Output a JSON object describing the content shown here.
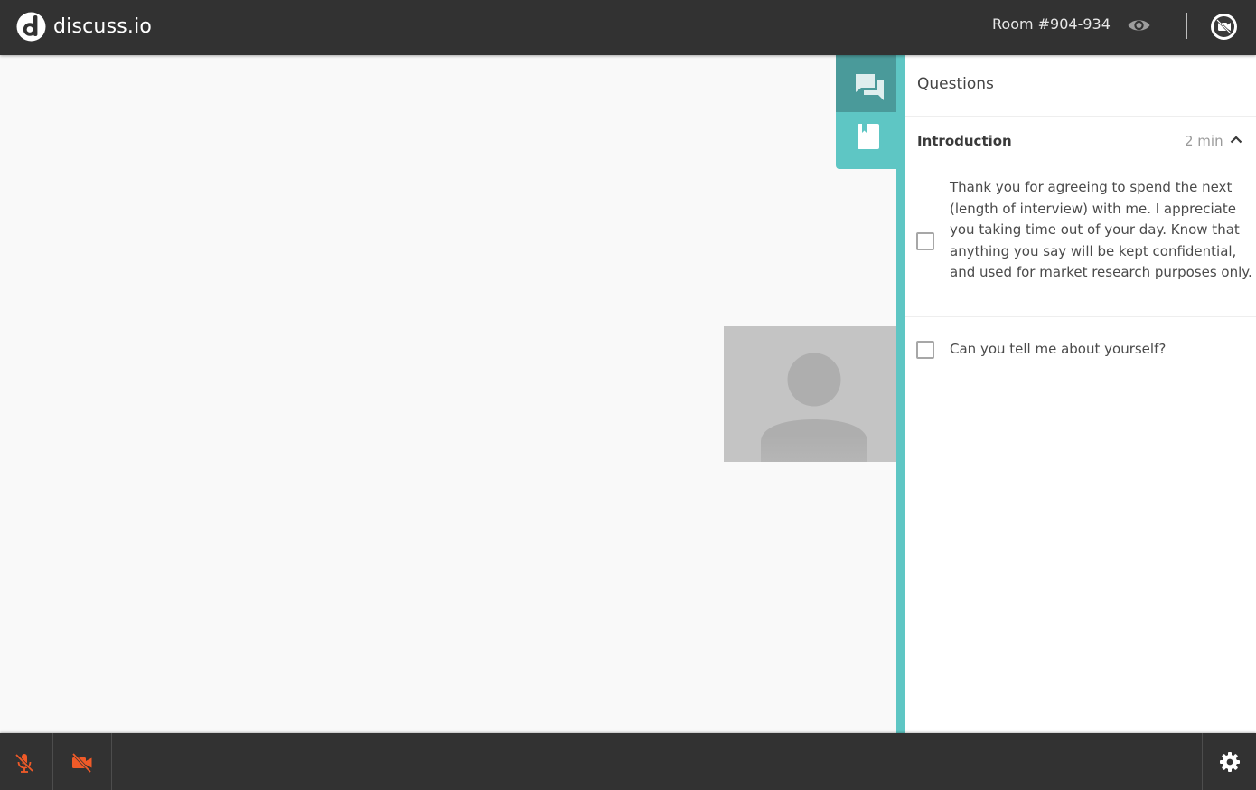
{
  "header": {
    "app_name": "discuss.io",
    "room_label": "Room #904-934",
    "icons": {
      "logo": "discuss-io-logo-icon",
      "view": "eye-icon",
      "camera_status": "camera-off-icon"
    }
  },
  "sidebar": {
    "tabs": [
      {
        "name": "chat",
        "icon": "chat-bubbles-icon"
      },
      {
        "name": "discussion-guide",
        "icon": "bookmark-book-icon"
      }
    ],
    "accent_color": "#5ec6c4"
  },
  "questions_panel": {
    "title": "Questions",
    "section": {
      "title": "Introduction",
      "duration": "2 min",
      "expanded": true
    },
    "items": [
      {
        "text": "Thank you for agreeing to spend the next (length of interview) with me. I appreciate you taking time out of your day. Know that anything you say will be kept confidential, and used for market research purposes only.",
        "checked": false
      },
      {
        "text": "Can you tell me about yourself?",
        "checked": false
      }
    ]
  },
  "video": {
    "participant_placeholder_icon": "avatar-placeholder-icon"
  },
  "footer": {
    "controls": [
      {
        "name": "microphone",
        "icon": "mic-off-icon",
        "state": "off"
      },
      {
        "name": "camera",
        "icon": "video-off-icon",
        "state": "off"
      },
      {
        "name": "settings",
        "icon": "gear-icon"
      }
    ],
    "off_color": "#f05a28"
  }
}
